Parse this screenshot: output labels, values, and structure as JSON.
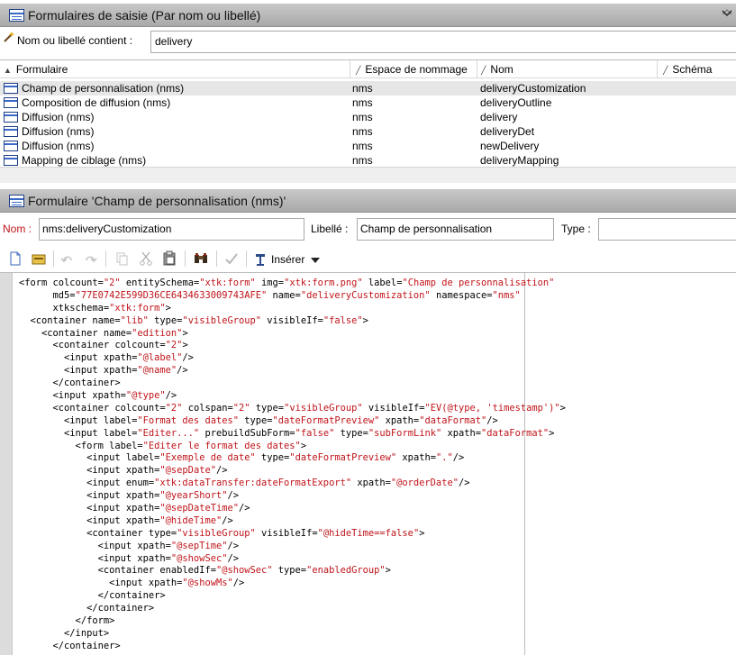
{
  "list_panel": {
    "title": "Formulaires de saisie (Par nom ou libellé)",
    "filter_label": "Nom ou libellé contient :",
    "filter_value": "delivery"
  },
  "grid": {
    "columns": [
      "Formulaire",
      "Espace de nommage",
      "Nom",
      "Schéma"
    ],
    "rows": [
      {
        "label": "Champ de personnalisation (nms)",
        "namespace": "nms",
        "name": "deliveryCustomization",
        "schema": ""
      },
      {
        "label": "Composition de diffusion (nms)",
        "namespace": "nms",
        "name": "deliveryOutline",
        "schema": ""
      },
      {
        "label": "Diffusion (nms)",
        "namespace": "nms",
        "name": "delivery",
        "schema": ""
      },
      {
        "label": "Diffusion (nms)",
        "namespace": "nms",
        "name": "deliveryDet",
        "schema": ""
      },
      {
        "label": "Diffusion (nms)",
        "namespace": "nms",
        "name": "newDelivery",
        "schema": ""
      },
      {
        "label": "Mapping de ciblage (nms)",
        "namespace": "nms",
        "name": "deliveryMapping",
        "schema": ""
      }
    ]
  },
  "detail_panel": {
    "title": "Formulaire 'Champ de personnalisation (nms)'",
    "name_label": "Nom :",
    "name_value": "nms:deliveryCustomization",
    "label_label": "Libellé :",
    "label_value": "Champ de personnalisation",
    "type_label": "Type :",
    "type_value": ""
  },
  "toolbar": {
    "insert_label": "Insérer"
  },
  "colors": {
    "accent_red": "#c0141a",
    "selection": "#e6e6e6",
    "title_bar": "#b5b5b5"
  },
  "editor": {
    "lines": [
      [
        [
          "p",
          "<form colcount="
        ],
        [
          "v",
          "\"2\""
        ],
        [
          "p",
          " entitySchema="
        ],
        [
          "v",
          "\"xtk:form\""
        ],
        [
          "p",
          " img="
        ],
        [
          "v",
          "\"xtk:form.png\""
        ],
        [
          "p",
          " label="
        ],
        [
          "v",
          "\"Champ de personnalisation\""
        ]
      ],
      [
        [
          "p",
          "      md5="
        ],
        [
          "v",
          "\"77E0742E599D36CE6434633009743AFE\""
        ],
        [
          "p",
          " name="
        ],
        [
          "v",
          "\"deliveryCustomization\""
        ],
        [
          "p",
          " namespace="
        ],
        [
          "v",
          "\"nms\""
        ]
      ],
      [
        [
          "p",
          "      xtkschema="
        ],
        [
          "v",
          "\"xtk:form\""
        ],
        [
          "p",
          ">"
        ]
      ],
      [
        [
          "p",
          "  <container name="
        ],
        [
          "v",
          "\"lib\""
        ],
        [
          "p",
          " type="
        ],
        [
          "v",
          "\"visibleGroup\""
        ],
        [
          "p",
          " visibleIf="
        ],
        [
          "v",
          "\"false\""
        ],
        [
          "p",
          ">"
        ]
      ],
      [
        [
          "p",
          "    <container name="
        ],
        [
          "v",
          "\"edition\""
        ],
        [
          "p",
          ">"
        ]
      ],
      [
        [
          "p",
          "      <container colcount="
        ],
        [
          "v",
          "\"2\""
        ],
        [
          "p",
          ">"
        ]
      ],
      [
        [
          "p",
          "        <input xpath="
        ],
        [
          "v",
          "\"@label\""
        ],
        [
          "p",
          "/>"
        ]
      ],
      [
        [
          "p",
          "        <input xpath="
        ],
        [
          "v",
          "\"@name\""
        ],
        [
          "p",
          "/>"
        ]
      ],
      [
        [
          "p",
          "      </container>"
        ]
      ],
      [
        [
          "p",
          "      <input xpath="
        ],
        [
          "v",
          "\"@type\""
        ],
        [
          "p",
          "/>"
        ]
      ],
      [
        [
          "p",
          "      <container colcount="
        ],
        [
          "v",
          "\"2\""
        ],
        [
          "p",
          " colspan="
        ],
        [
          "v",
          "\"2\""
        ],
        [
          "p",
          " type="
        ],
        [
          "v",
          "\"visibleGroup\""
        ],
        [
          "p",
          " visibleIf="
        ],
        [
          "v",
          "\"EV(@type, 'timestamp')\""
        ],
        [
          "p",
          ">"
        ]
      ],
      [
        [
          "p",
          "        <input label="
        ],
        [
          "v",
          "\"Format des dates\""
        ],
        [
          "p",
          " type="
        ],
        [
          "v",
          "\"dateFormatPreview\""
        ],
        [
          "p",
          " xpath="
        ],
        [
          "v",
          "\"dataFormat\""
        ],
        [
          "p",
          "/>"
        ]
      ],
      [
        [
          "p",
          "        <input label="
        ],
        [
          "v",
          "\"Editer...\""
        ],
        [
          "p",
          " prebuildSubForm="
        ],
        [
          "v",
          "\"false\""
        ],
        [
          "p",
          " type="
        ],
        [
          "v",
          "\"subFormLink\""
        ],
        [
          "p",
          " xpath="
        ],
        [
          "v",
          "\"dataFormat\""
        ],
        [
          "p",
          ">"
        ]
      ],
      [
        [
          "p",
          "          <form label="
        ],
        [
          "v",
          "\"Editer le format des dates\""
        ],
        [
          "p",
          ">"
        ]
      ],
      [
        [
          "p",
          "            <input label="
        ],
        [
          "v",
          "\"Exemple de date\""
        ],
        [
          "p",
          " type="
        ],
        [
          "v",
          "\"dateFormatPreview\""
        ],
        [
          "p",
          " xpath="
        ],
        [
          "v",
          "\".\""
        ],
        [
          "p",
          "/>"
        ]
      ],
      [
        [
          "p",
          "            <input xpath="
        ],
        [
          "v",
          "\"@sepDate\""
        ],
        [
          "p",
          "/>"
        ]
      ],
      [
        [
          "p",
          "            <input enum="
        ],
        [
          "v",
          "\"xtk:dataTransfer:dateFormatExport\""
        ],
        [
          "p",
          " xpath="
        ],
        [
          "v",
          "\"@orderDate\""
        ],
        [
          "p",
          "/>"
        ]
      ],
      [
        [
          "p",
          "            <input xpath="
        ],
        [
          "v",
          "\"@yearShort\""
        ],
        [
          "p",
          "/>"
        ]
      ],
      [
        [
          "p",
          "            <input xpath="
        ],
        [
          "v",
          "\"@sepDateTime\""
        ],
        [
          "p",
          "/>"
        ]
      ],
      [
        [
          "p",
          "            <input xpath="
        ],
        [
          "v",
          "\"@hideTime\""
        ],
        [
          "p",
          "/>"
        ]
      ],
      [
        [
          "p",
          "            <container type="
        ],
        [
          "v",
          "\"visibleGroup\""
        ],
        [
          "p",
          " visibleIf="
        ],
        [
          "v",
          "\"@hideTime==false\""
        ],
        [
          "p",
          ">"
        ]
      ],
      [
        [
          "p",
          "              <input xpath="
        ],
        [
          "v",
          "\"@sepTime\""
        ],
        [
          "p",
          "/>"
        ]
      ],
      [
        [
          "p",
          "              <input xpath="
        ],
        [
          "v",
          "\"@showSec\""
        ],
        [
          "p",
          "/>"
        ]
      ],
      [
        [
          "p",
          "              <container enabledIf="
        ],
        [
          "v",
          "\"@showSec\""
        ],
        [
          "p",
          " type="
        ],
        [
          "v",
          "\"enabledGroup\""
        ],
        [
          "p",
          ">"
        ]
      ],
      [
        [
          "p",
          "                <input xpath="
        ],
        [
          "v",
          "\"@showMs\""
        ],
        [
          "p",
          "/>"
        ]
      ],
      [
        [
          "p",
          "              </container>"
        ]
      ],
      [
        [
          "p",
          "            </container>"
        ]
      ],
      [
        [
          "p",
          "          </form>"
        ]
      ],
      [
        [
          "p",
          "        </input>"
        ]
      ],
      [
        [
          "p",
          "      </container>"
        ]
      ]
    ]
  }
}
